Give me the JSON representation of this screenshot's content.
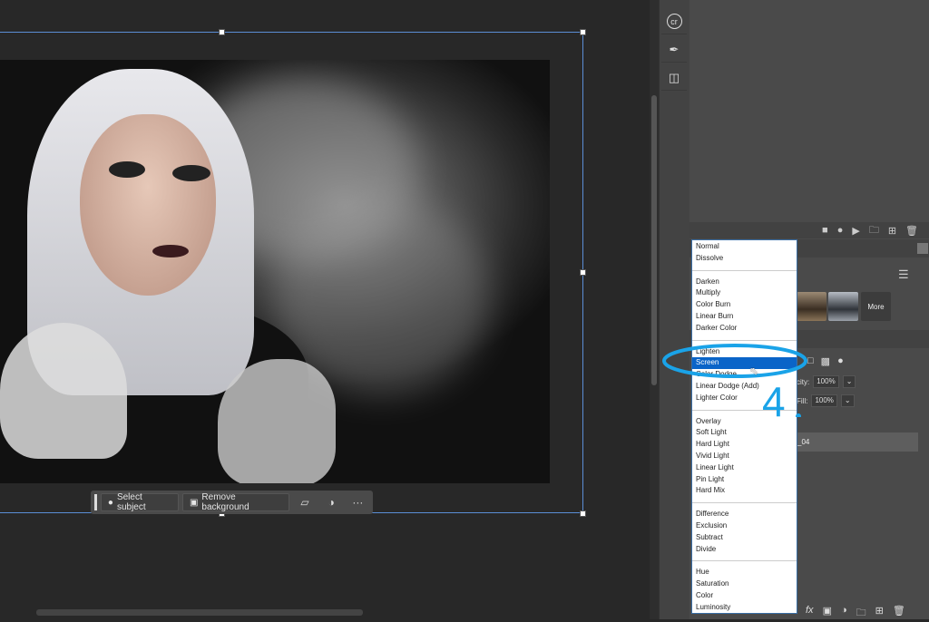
{
  "taskbar": {
    "select_subject": "Select subject",
    "remove_background": "Remove background"
  },
  "side_strip": {
    "icons": [
      "camera-raw-icon",
      "brush-presets-icon",
      "library-icon"
    ],
    "cr_label": "cr"
  },
  "presets": {
    "more_label": "More"
  },
  "blend_modes": {
    "groups": [
      [
        "Normal",
        "Dissolve"
      ],
      [
        "Darken",
        "Multiply",
        "Color Burn",
        "Linear Burn",
        "Darker Color"
      ],
      [
        "Lighten",
        "Screen",
        "Color Dodge",
        "Linear Dodge (Add)",
        "Lighter Color"
      ],
      [
        "Overlay",
        "Soft Light",
        "Hard Light",
        "Vivid Light",
        "Linear Light",
        "Pin Light",
        "Hard Mix"
      ],
      [
        "Difference",
        "Exclusion",
        "Subtract",
        "Divide"
      ],
      [
        "Hue",
        "Saturation",
        "Color",
        "Luminosity"
      ]
    ],
    "selected": "Screen"
  },
  "layers": {
    "opacity_label": "city:",
    "opacity_value": "100%",
    "fill_label": "Fill:",
    "fill_value": "100%",
    "layer_name": "_04"
  },
  "annotation": {
    "step": "4",
    "color": "#1aa3e8"
  },
  "colors": {
    "selection": "#0a64c8",
    "frame": "#5b8ed6",
    "panel": "#4a4a4a",
    "canvas": "#282828"
  }
}
